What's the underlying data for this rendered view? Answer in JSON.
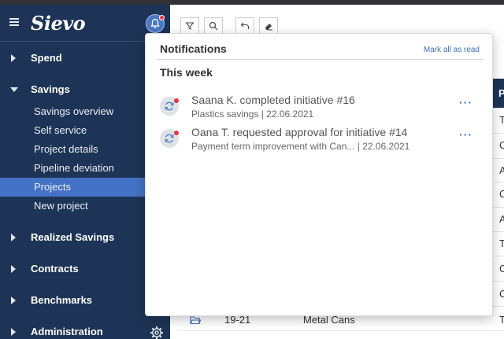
{
  "app": {
    "logo": "Sievo"
  },
  "sidebar": {
    "sections": [
      {
        "label": "Spend"
      },
      {
        "label": "Savings"
      },
      {
        "label": "Realized Savings"
      },
      {
        "label": "Contracts"
      },
      {
        "label": "Benchmarks"
      },
      {
        "label": "Administration"
      }
    ],
    "savings_items": [
      {
        "label": "Savings overview"
      },
      {
        "label": "Self service"
      },
      {
        "label": "Project details"
      },
      {
        "label": "Pipeline deviation"
      },
      {
        "label": "Projects",
        "active": true
      },
      {
        "label": "New project"
      }
    ]
  },
  "notifications": {
    "title": "Notifications",
    "mark_all": "Mark all as read",
    "group_title": "This week",
    "items": [
      {
        "title": "Saana K. completed initiative #16",
        "subtitle": "Plastics savings  |  22.06.2021",
        "more": "···"
      },
      {
        "title": "Oana T. requested approval for initiative #14",
        "subtitle": "Payment term improvement with Can...  |  22.06.2021",
        "more": "···"
      }
    ]
  },
  "table": {
    "header_partial": "P",
    "cells_partial": [
      "T",
      "C",
      "A",
      "C",
      "A",
      "T",
      "C",
      "C"
    ],
    "visible_row": {
      "id": "19-21",
      "name": "Metal Cans",
      "last": "T"
    }
  },
  "colors": {
    "sidebar": "#1e3456",
    "active": "#4472c4",
    "accent": "#3e6fc1",
    "badge": "#e7344b"
  }
}
